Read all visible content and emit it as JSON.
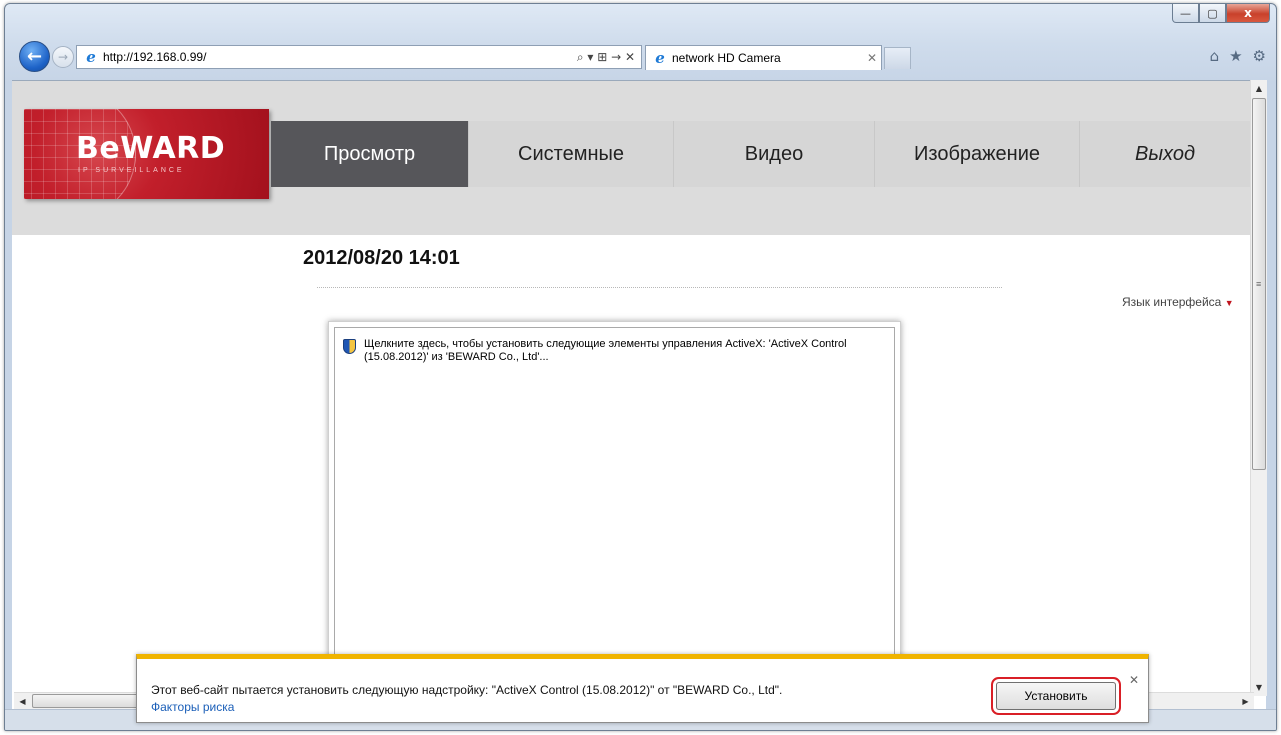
{
  "window": {
    "minimize_label": "—",
    "maximize_label": "▢",
    "close_label": "x"
  },
  "browser": {
    "back_label": "←",
    "forward_label": "→",
    "url": "http://192.168.0.99/",
    "address_tools": "⌕ ▾ ⊞ → ✕",
    "tab_title": "network HD Camera",
    "tab_close": "✕",
    "home_icon": "⌂",
    "favorites_icon": "★",
    "tools_icon": "⚙",
    "ie_icon": "e"
  },
  "camera": {
    "logo_text": "BeWARD",
    "logo_sub": "IP SURVEILLANCE",
    "menu": [
      {
        "label": "Просмотр"
      },
      {
        "label": "Системные"
      },
      {
        "label": "Видео"
      },
      {
        "label": "Изображение"
      },
      {
        "label": "Выход"
      }
    ],
    "datetime": "2012/08/20 14:01",
    "language_link": "Язык интерфейса",
    "language_arrow": "▼"
  },
  "activex": {
    "message": "Щелкните здесь, чтобы установить следующие элементы управления ActiveX: 'ActiveX Control (15.08.2012)' из 'BEWARD Co., Ltd'..."
  },
  "notification": {
    "message": "Этот веб-сайт пытается установить следующую надстройку: \"ActiveX Control (15.08.2012)\" от \"BEWARD Co., Ltd\".",
    "risk_link": "Факторы риска",
    "install_label": "Установить",
    "close_label": "✕"
  },
  "scrollbars": {
    "up": "▲",
    "down": "▼",
    "left": "◀",
    "right": "▶",
    "grip": "≡"
  }
}
